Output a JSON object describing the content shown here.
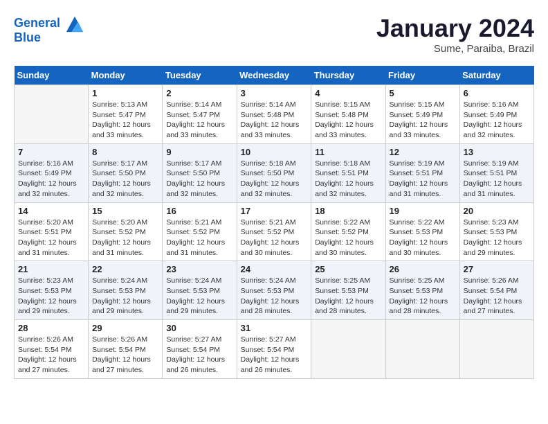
{
  "header": {
    "logo_line1": "General",
    "logo_line2": "Blue",
    "month": "January 2024",
    "location": "Sume, Paraiba, Brazil"
  },
  "days_of_week": [
    "Sunday",
    "Monday",
    "Tuesday",
    "Wednesday",
    "Thursday",
    "Friday",
    "Saturday"
  ],
  "weeks": [
    [
      {
        "day": "",
        "info": ""
      },
      {
        "day": "1",
        "info": "Sunrise: 5:13 AM\nSunset: 5:47 PM\nDaylight: 12 hours\nand 33 minutes."
      },
      {
        "day": "2",
        "info": "Sunrise: 5:14 AM\nSunset: 5:47 PM\nDaylight: 12 hours\nand 33 minutes."
      },
      {
        "day": "3",
        "info": "Sunrise: 5:14 AM\nSunset: 5:48 PM\nDaylight: 12 hours\nand 33 minutes."
      },
      {
        "day": "4",
        "info": "Sunrise: 5:15 AM\nSunset: 5:48 PM\nDaylight: 12 hours\nand 33 minutes."
      },
      {
        "day": "5",
        "info": "Sunrise: 5:15 AM\nSunset: 5:49 PM\nDaylight: 12 hours\nand 33 minutes."
      },
      {
        "day": "6",
        "info": "Sunrise: 5:16 AM\nSunset: 5:49 PM\nDaylight: 12 hours\nand 32 minutes."
      }
    ],
    [
      {
        "day": "7",
        "info": "Sunrise: 5:16 AM\nSunset: 5:49 PM\nDaylight: 12 hours\nand 32 minutes."
      },
      {
        "day": "8",
        "info": "Sunrise: 5:17 AM\nSunset: 5:50 PM\nDaylight: 12 hours\nand 32 minutes."
      },
      {
        "day": "9",
        "info": "Sunrise: 5:17 AM\nSunset: 5:50 PM\nDaylight: 12 hours\nand 32 minutes."
      },
      {
        "day": "10",
        "info": "Sunrise: 5:18 AM\nSunset: 5:50 PM\nDaylight: 12 hours\nand 32 minutes."
      },
      {
        "day": "11",
        "info": "Sunrise: 5:18 AM\nSunset: 5:51 PM\nDaylight: 12 hours\nand 32 minutes."
      },
      {
        "day": "12",
        "info": "Sunrise: 5:19 AM\nSunset: 5:51 PM\nDaylight: 12 hours\nand 31 minutes."
      },
      {
        "day": "13",
        "info": "Sunrise: 5:19 AM\nSunset: 5:51 PM\nDaylight: 12 hours\nand 31 minutes."
      }
    ],
    [
      {
        "day": "14",
        "info": "Sunrise: 5:20 AM\nSunset: 5:51 PM\nDaylight: 12 hours\nand 31 minutes."
      },
      {
        "day": "15",
        "info": "Sunrise: 5:20 AM\nSunset: 5:52 PM\nDaylight: 12 hours\nand 31 minutes."
      },
      {
        "day": "16",
        "info": "Sunrise: 5:21 AM\nSunset: 5:52 PM\nDaylight: 12 hours\nand 31 minutes."
      },
      {
        "day": "17",
        "info": "Sunrise: 5:21 AM\nSunset: 5:52 PM\nDaylight: 12 hours\nand 30 minutes."
      },
      {
        "day": "18",
        "info": "Sunrise: 5:22 AM\nSunset: 5:52 PM\nDaylight: 12 hours\nand 30 minutes."
      },
      {
        "day": "19",
        "info": "Sunrise: 5:22 AM\nSunset: 5:53 PM\nDaylight: 12 hours\nand 30 minutes."
      },
      {
        "day": "20",
        "info": "Sunrise: 5:23 AM\nSunset: 5:53 PM\nDaylight: 12 hours\nand 29 minutes."
      }
    ],
    [
      {
        "day": "21",
        "info": "Sunrise: 5:23 AM\nSunset: 5:53 PM\nDaylight: 12 hours\nand 29 minutes."
      },
      {
        "day": "22",
        "info": "Sunrise: 5:24 AM\nSunset: 5:53 PM\nDaylight: 12 hours\nand 29 minutes."
      },
      {
        "day": "23",
        "info": "Sunrise: 5:24 AM\nSunset: 5:53 PM\nDaylight: 12 hours\nand 29 minutes."
      },
      {
        "day": "24",
        "info": "Sunrise: 5:24 AM\nSunset: 5:53 PM\nDaylight: 12 hours\nand 28 minutes."
      },
      {
        "day": "25",
        "info": "Sunrise: 5:25 AM\nSunset: 5:53 PM\nDaylight: 12 hours\nand 28 minutes."
      },
      {
        "day": "26",
        "info": "Sunrise: 5:25 AM\nSunset: 5:53 PM\nDaylight: 12 hours\nand 28 minutes."
      },
      {
        "day": "27",
        "info": "Sunrise: 5:26 AM\nSunset: 5:54 PM\nDaylight: 12 hours\nand 27 minutes."
      }
    ],
    [
      {
        "day": "28",
        "info": "Sunrise: 5:26 AM\nSunset: 5:54 PM\nDaylight: 12 hours\nand 27 minutes."
      },
      {
        "day": "29",
        "info": "Sunrise: 5:26 AM\nSunset: 5:54 PM\nDaylight: 12 hours\nand 27 minutes."
      },
      {
        "day": "30",
        "info": "Sunrise: 5:27 AM\nSunset: 5:54 PM\nDaylight: 12 hours\nand 26 minutes."
      },
      {
        "day": "31",
        "info": "Sunrise: 5:27 AM\nSunset: 5:54 PM\nDaylight: 12 hours\nand 26 minutes."
      },
      {
        "day": "",
        "info": ""
      },
      {
        "day": "",
        "info": ""
      },
      {
        "day": "",
        "info": ""
      }
    ]
  ]
}
